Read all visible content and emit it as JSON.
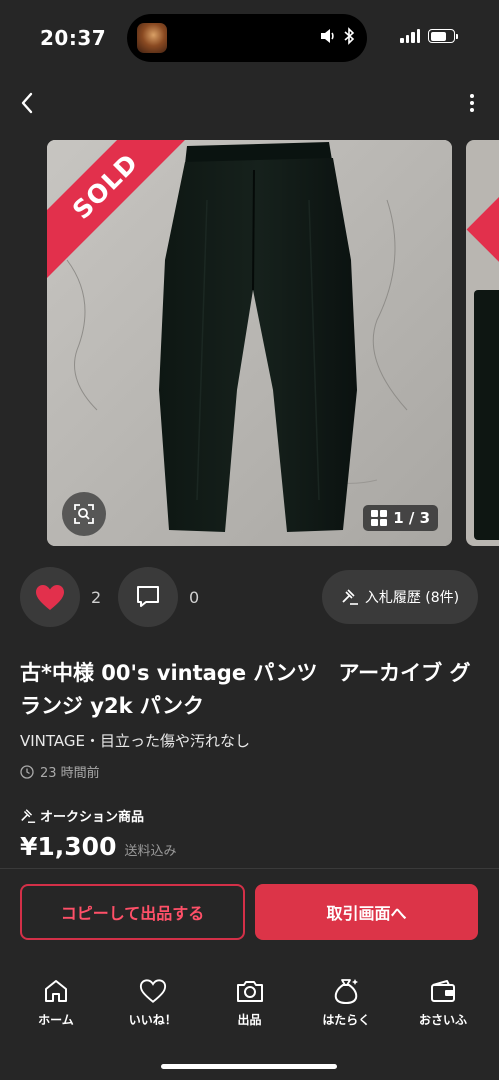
{
  "status_bar": {
    "time": "20:37"
  },
  "item": {
    "badge": "SOLD",
    "photo_page": "1 / 3",
    "likes": "2",
    "comments": "0",
    "bid_history_label": "入札履歴 (8件)",
    "title": "古*中様 00's vintage パンツ　アーカイブ グランジ y2k パンク",
    "condition": "VINTAGE・目立った傷や汚れなし",
    "posted": "23 時間前",
    "auction_label": "オークション商品",
    "price": "¥1,300",
    "shipping": "送料込み"
  },
  "actions": {
    "copy_label": "コピーして出品する",
    "trade_label": "取引画面へ"
  },
  "tabs": [
    {
      "label": "ホーム",
      "icon": "home-icon"
    },
    {
      "label": "いいね！",
      "icon": "heart-icon"
    },
    {
      "label": "出品",
      "icon": "camera-icon"
    },
    {
      "label": "はたらく",
      "icon": "money-bag-icon"
    },
    {
      "label": "おさいふ",
      "icon": "wallet-icon"
    }
  ],
  "colors": {
    "accent": "#dc3448",
    "background": "#262626"
  }
}
